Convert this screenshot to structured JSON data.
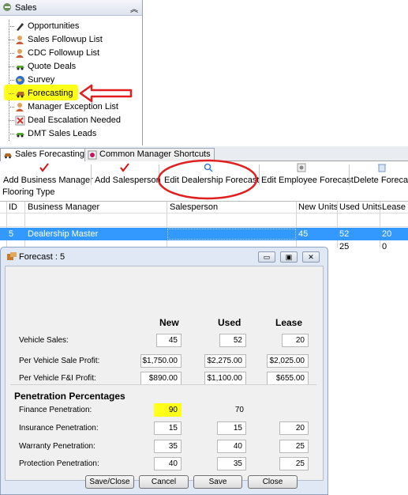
{
  "tree": {
    "title": "Sales",
    "items": [
      {
        "label": "Opportunities",
        "icon": "pencil-icon"
      },
      {
        "label": "Sales Followup List",
        "icon": "people-icon"
      },
      {
        "label": "CDC Followup List",
        "icon": "people-icon"
      },
      {
        "label": "Quote Deals",
        "icon": "car-icon"
      },
      {
        "label": "Survey",
        "icon": "globe-icon"
      },
      {
        "label": "Forecasting",
        "icon": "forecast-icon"
      },
      {
        "label": "Manager Exception List",
        "icon": "people-icon"
      },
      {
        "label": "Deal Escalation Needed",
        "icon": "escalation-icon"
      },
      {
        "label": "DMT Sales Leads",
        "icon": "car-icon"
      }
    ]
  },
  "tabs": [
    "Sales Forecasting",
    "Common Manager Shortcuts"
  ],
  "toolbar": {
    "buttons": [
      "Add Business Manager",
      "Add Salesperson",
      "Edit Dealership Forecast",
      "Edit Employee Forecast",
      "Delete Forecast"
    ],
    "flooring": "Flooring Type"
  },
  "grid": {
    "columns": [
      "ID",
      "Business Manager",
      "Salesperson",
      "New Units",
      "Used Units",
      "Lease U"
    ],
    "rows": [
      {
        "id": "5",
        "manager": "Dealership Master",
        "salesperson": "",
        "new": "45",
        "used": "52",
        "lease": "20"
      },
      {
        "id": "",
        "manager": "",
        "salesperson": "",
        "new": "",
        "used": "25",
        "lease": "0"
      }
    ]
  },
  "dialog": {
    "title": "Forecast : 5",
    "col_new": "New",
    "col_used": "Used",
    "col_lease": "Lease",
    "rows": [
      {
        "label": "Vehicle Sales:",
        "new": "45",
        "used": "52",
        "lease": "20"
      },
      {
        "label": "Per Vehicle Sale Profit:",
        "new": "$1,750.00",
        "used": "$2,275.00",
        "lease": "$2,025.00"
      },
      {
        "label": "Per Vehicle F&I Profit:",
        "new": "$890.00",
        "used": "$1,100.00",
        "lease": "$655.00"
      }
    ],
    "penetration_title": "Penetration Percentages",
    "penetration": [
      {
        "label": "Finance Penetration:",
        "new": "90",
        "used": "70",
        "lease": ""
      },
      {
        "label": "Insurance Penetration:",
        "new": "15",
        "used": "15",
        "lease": "20"
      },
      {
        "label": "Warranty Penetration:",
        "new": "35",
        "used": "40",
        "lease": "25"
      },
      {
        "label": "Protection Penetration:",
        "new": "40",
        "used": "35",
        "lease": "25"
      }
    ],
    "buttons": [
      "Save/Close",
      "Cancel",
      "Save",
      "Close"
    ]
  },
  "colors": {
    "highlight": "#ffff1a",
    "annotation": "#e02020",
    "selection": "#3399ff"
  }
}
